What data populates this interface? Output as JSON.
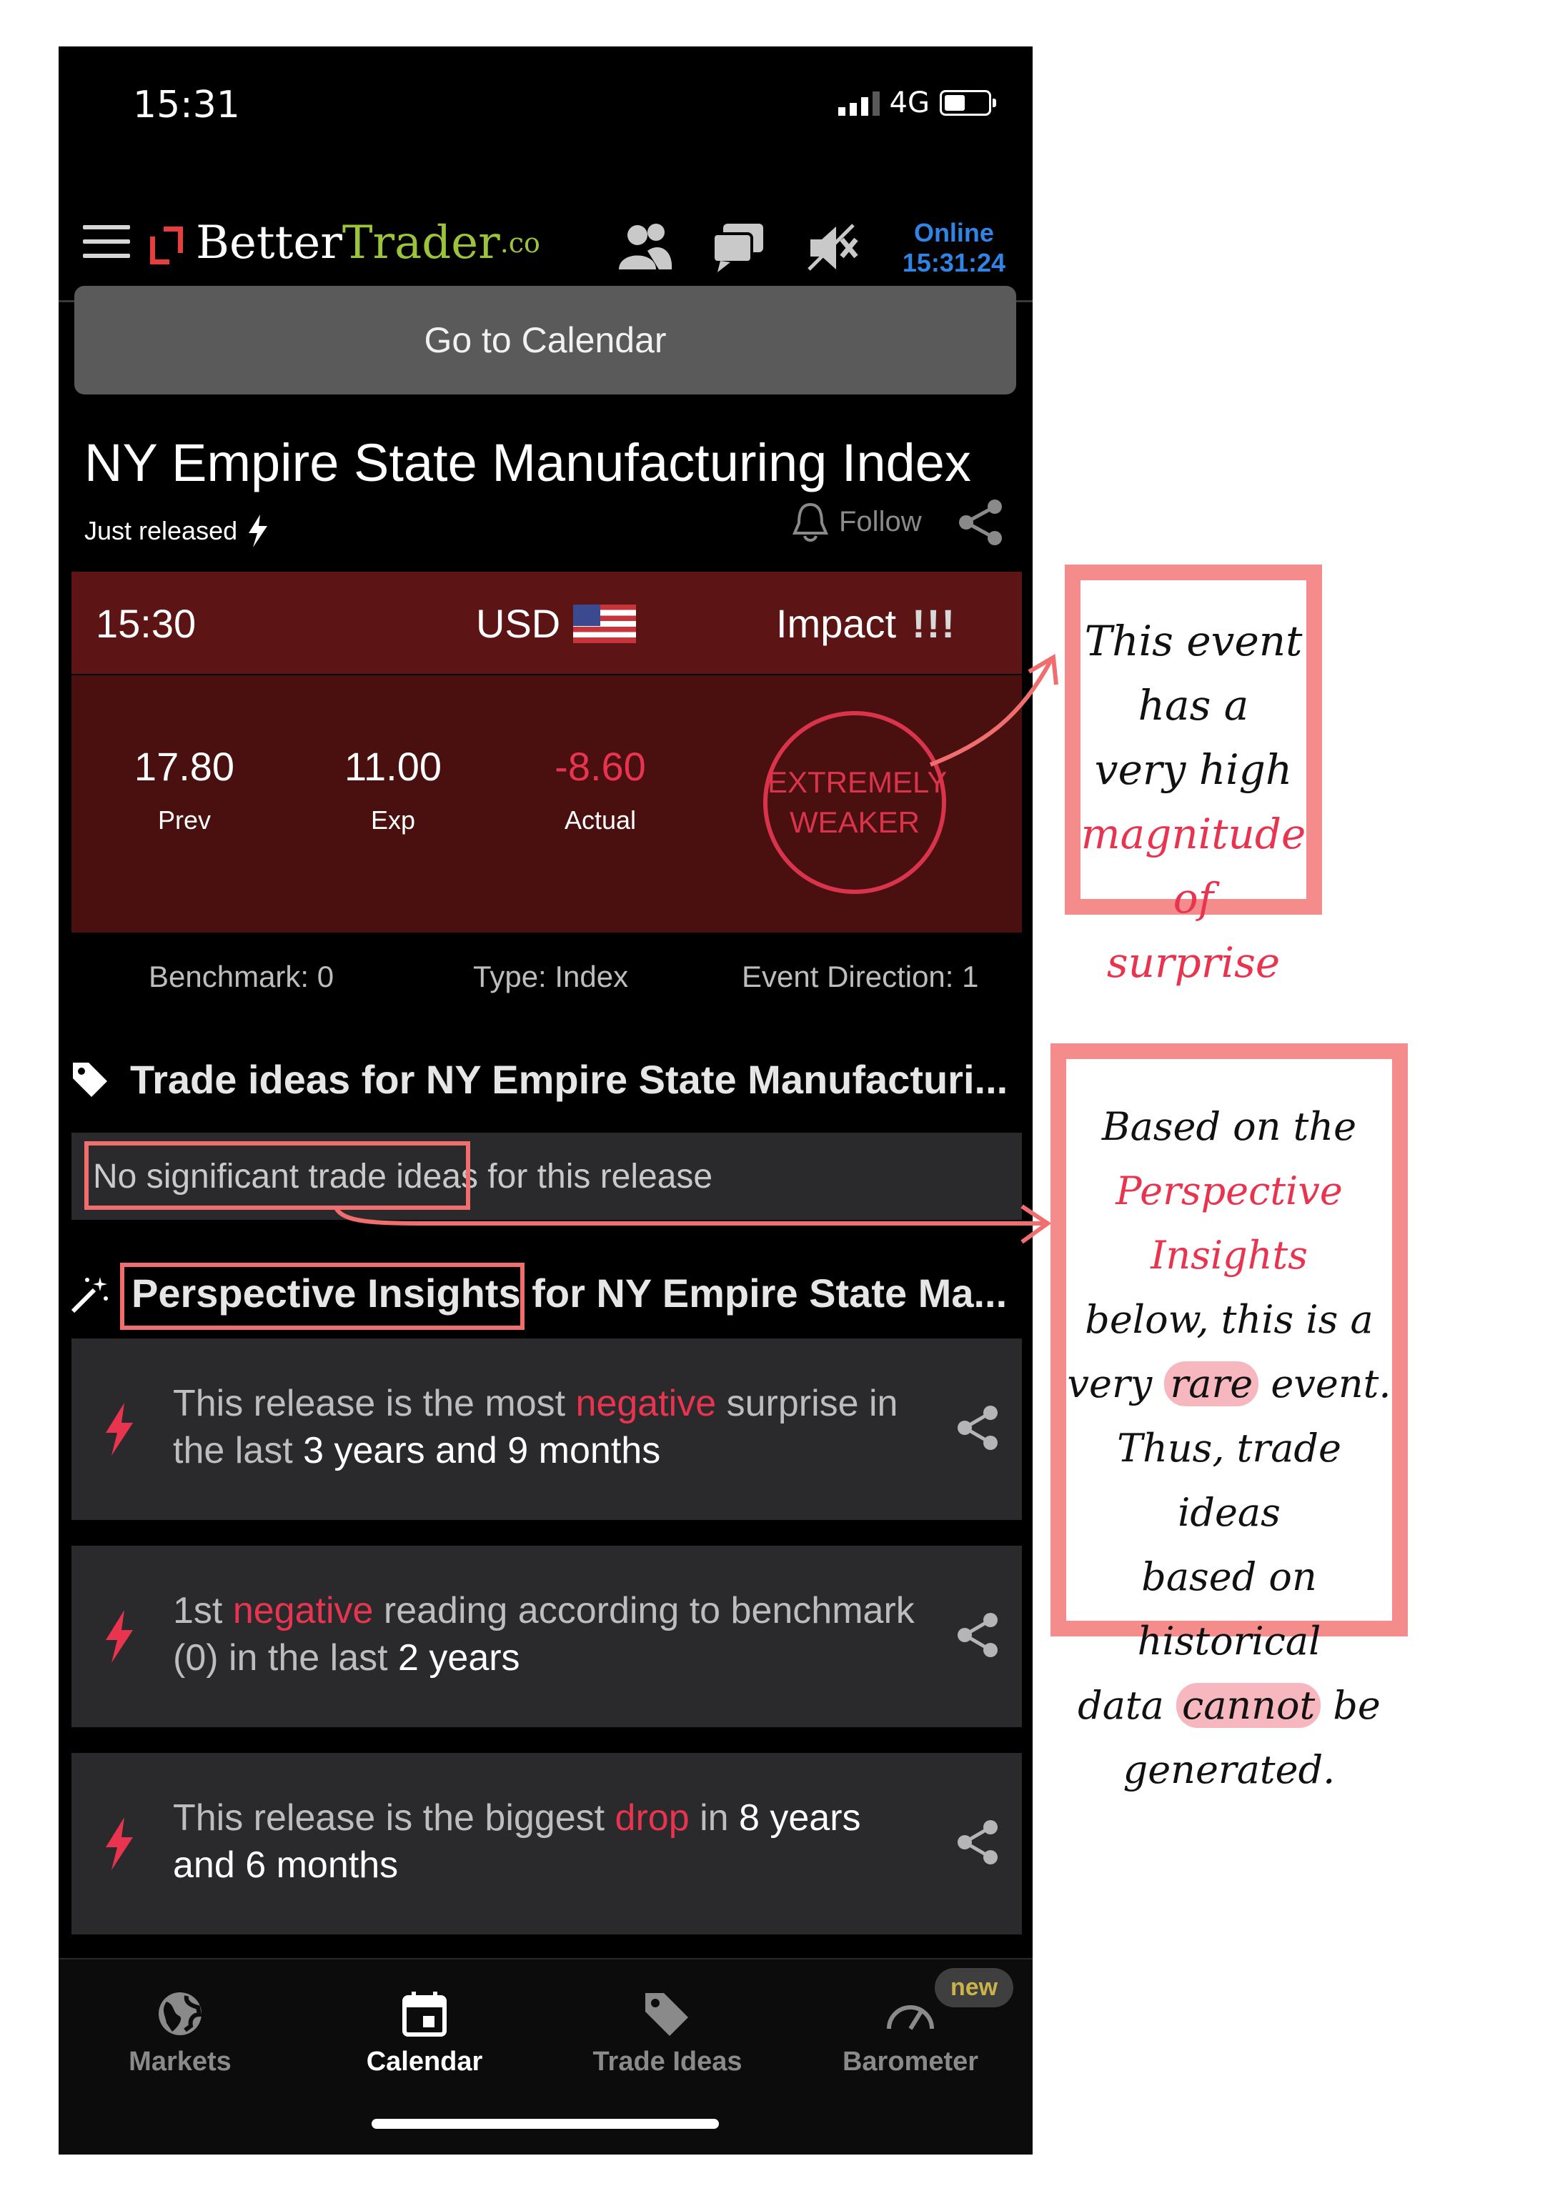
{
  "status_bar": {
    "time": "15:31",
    "network": "4G"
  },
  "header": {
    "brand_part1": "Better",
    "brand_part2": "Trader",
    "brand_part3": ".co",
    "online_label": "Online",
    "online_time": "15:31:24"
  },
  "calendar_button": "Go to Calendar",
  "event": {
    "title": "NY Empire State Manufacturing Index",
    "released": "Just released",
    "follow": "Follow",
    "time": "15:30",
    "currency": "USD",
    "impact_label": "Impact",
    "impact_marks": "!!!",
    "prev_value": "17.80",
    "prev_label": "Prev",
    "exp_value": "11.00",
    "exp_label": "Exp",
    "actual_value": "-8.60",
    "actual_label": "Actual",
    "surprise_line1": "EXTREMELY",
    "surprise_line2": "WEAKER",
    "benchmark": "Benchmark: 0",
    "type": "Type: Index",
    "direction": "Event Direction: 1"
  },
  "trade_ideas": {
    "title": "Trade ideas for NY Empire State Manufacturi...",
    "message": "No significant trade ideas for this release"
  },
  "insights": {
    "title": "Perspective Insights for NY Empire State Ma...",
    "item1": {
      "a": "This release is the most ",
      "b": "negative",
      "c": " surprise in the last ",
      "d": "3",
      "e": " years and ",
      "f": "9",
      "g": " months"
    },
    "item2": {
      "a": "1st ",
      "b": "negative",
      "c": " reading according to benchmark (0) in the last ",
      "d": "2",
      "e": " years"
    },
    "item3": {
      "a": "This release is the biggest ",
      "b": "drop",
      "c": " in ",
      "d": "8",
      "e": " years and ",
      "f": "6",
      "g": " months"
    }
  },
  "tabs": {
    "markets": "Markets",
    "calendar": "Calendar",
    "trade_ideas": "Trade Ideas",
    "barometer": "Barometer",
    "new_badge": "new"
  },
  "annotations": {
    "note1": {
      "l1": "This event",
      "l2": "has a",
      "l3": "very high",
      "l4": "magnitude",
      "l5": "of surprise"
    },
    "note2": {
      "l1": "Based on the",
      "l2": "Perspective Insights",
      "l3": "below, this is a",
      "l4a": "very ",
      "l4b": "rare",
      "l4c": " event.",
      "l5": "Thus, trade ideas",
      "l6": "based on historical",
      "l7a": "data ",
      "l7b": "cannot",
      "l7c": " be",
      "l8": "generated."
    }
  },
  "colors": {
    "accent_red": "#e8344f",
    "brand_green": "#9cc43a",
    "online_blue": "#2f84e6",
    "annotation_pink": "#f58c8c"
  }
}
